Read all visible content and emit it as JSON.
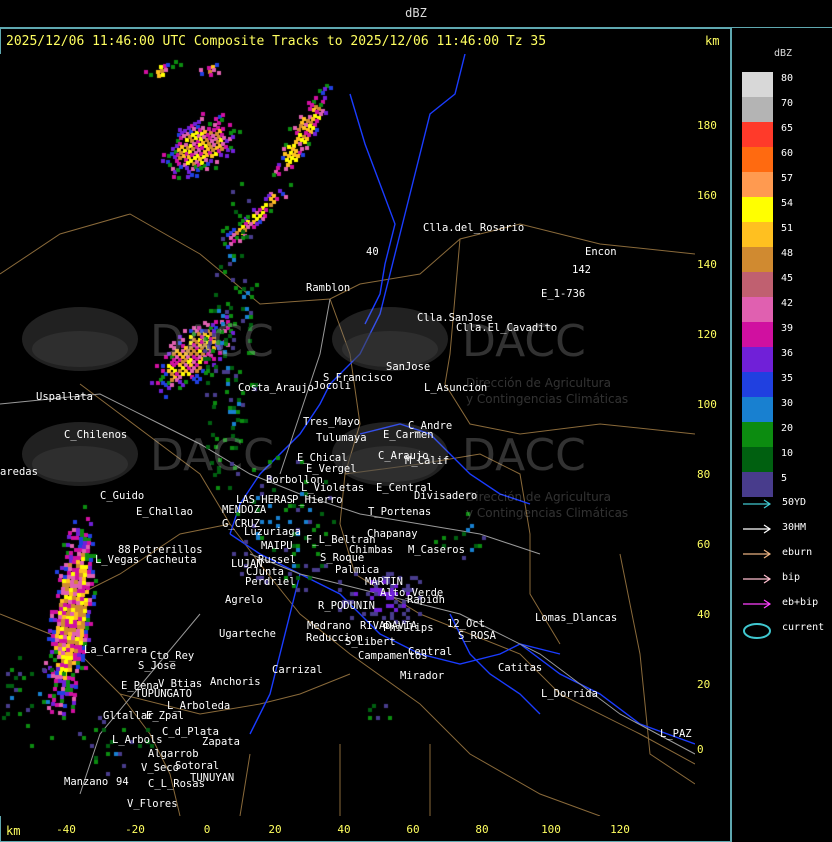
{
  "top_bar": {
    "title": "dBZ"
  },
  "header": {
    "title": "2025/12/06 11:46:00 UTC Composite Tracks to 2025/12/06 11:46:00 Tz 35",
    "km_label": "km"
  },
  "axes": {
    "x_unit": "km",
    "x_ticks": [
      "-40",
      "-20",
      "0",
      "20",
      "40",
      "60",
      "80",
      "100",
      "120"
    ],
    "y_ticks": [
      "180",
      "160",
      "140",
      "120",
      "100",
      "80",
      "60",
      "40",
      "20",
      "0"
    ]
  },
  "legend": {
    "title": "dBZ",
    "scale": [
      {
        "label": "80",
        "color": "#d8d8d8"
      },
      {
        "label": "70",
        "color": "#b4b4b4"
      },
      {
        "label": "65",
        "color": "#ff3a2a"
      },
      {
        "label": "60",
        "color": "#ff6a10"
      },
      {
        "label": "57",
        "color": "#ff9a50"
      },
      {
        "label": "54",
        "color": "#ffff00"
      },
      {
        "label": "51",
        "color": "#ffc020"
      },
      {
        "label": "48",
        "color": "#d08a30"
      },
      {
        "label": "45",
        "color": "#c06070"
      },
      {
        "label": "42",
        "color": "#e060b0"
      },
      {
        "label": "39",
        "color": "#d010a0"
      },
      {
        "label": "36",
        "color": "#7020d8"
      },
      {
        "label": "35",
        "color": "#2040e0"
      },
      {
        "label": "30",
        "color": "#1880d0"
      },
      {
        "label": "20",
        "color": "#0c8c10"
      },
      {
        "label": "10",
        "color": "#006010"
      },
      {
        "label": "5",
        "color": "#483c8c"
      }
    ],
    "tracks": [
      {
        "label": "50YD",
        "color": "#40c8d0",
        "icon": "arrow"
      },
      {
        "label": "30HM",
        "color": "#ffffff",
        "icon": "arrow"
      },
      {
        "label": "eburn",
        "color": "#e8b080",
        "icon": "arrow"
      },
      {
        "label": "bip",
        "color": "#ffc0d0",
        "icon": "arrow"
      },
      {
        "label": "eb+bip",
        "color": "#ff40ff",
        "icon": "arrow"
      },
      {
        "label": "current",
        "color": "#40c8d0",
        "icon": "ellipse"
      }
    ]
  },
  "watermark": {
    "name": "DACC",
    "line1": "Dirección de Agricultura",
    "line2": "y Contingencias Climáticas"
  },
  "places": [
    "Clla.del_Rosario",
    "Encon",
    "142",
    "E_1-736",
    "Ramblon",
    "40",
    "Clla.SanJose",
    "Clla.El_Cavadito",
    "SanJose",
    "S_Francisco",
    "Jocoli",
    "L_Asuncion",
    "Uspallata",
    "Costa_Araujo",
    "Tres_Mayo",
    "C_Andre",
    "E_Carmen",
    "Tulumaya",
    "C_Chilenos",
    "C_Araujo",
    "M_Calif",
    "E_Chical",
    "E_Vergel",
    "aredas",
    "Borbollon",
    "L_Violetas",
    "E_Central",
    "Divisadero",
    "C_Guido",
    "P_Hierro",
    "LAS_HERAS",
    "E_Challao",
    "MENDOZA",
    "T_Portenas",
    "G_CRUZ",
    "Chapanay",
    "Luzuriaga",
    "F_L_Beltran",
    "88",
    "Potrerillos",
    "MAIPU",
    "Chimbas",
    "M_Caseros",
    "L_Vegas",
    "Cacheuta",
    "LUJAN",
    "Russel",
    "S_Roque",
    "Palmica",
    "CJunta",
    "MARTIN",
    "Perdriel",
    "Agrelo",
    "Alto_Verde",
    "Rapidh",
    "R_PODUNIN",
    "Lomas_Dlancas",
    "12_Oct",
    "Medrano",
    "RIVADAVIA",
    "Phillips",
    "Ugarteche",
    "Reduccion",
    "S_Libert",
    "S_ROSA",
    "Cto_Rey",
    "Campamentos",
    "Central",
    "La_Carrera",
    "Catitas",
    "Carrizal",
    "S_Jose",
    "Mirador",
    "V_Btias",
    "Anchoris",
    "E_Pena",
    "TUPUNGATO",
    "L_Dorrida",
    "L_Arboleda",
    "E_Zpal",
    "Gltallar",
    "L_Arbols",
    "C_d_Plata",
    "Zapata",
    "L_PAZ",
    "Algarrob",
    "V_Seco",
    "Sotoral",
    "TUNUYAN",
    "Manzano",
    "94",
    "C_L_Rosas",
    "V_Flores"
  ]
}
